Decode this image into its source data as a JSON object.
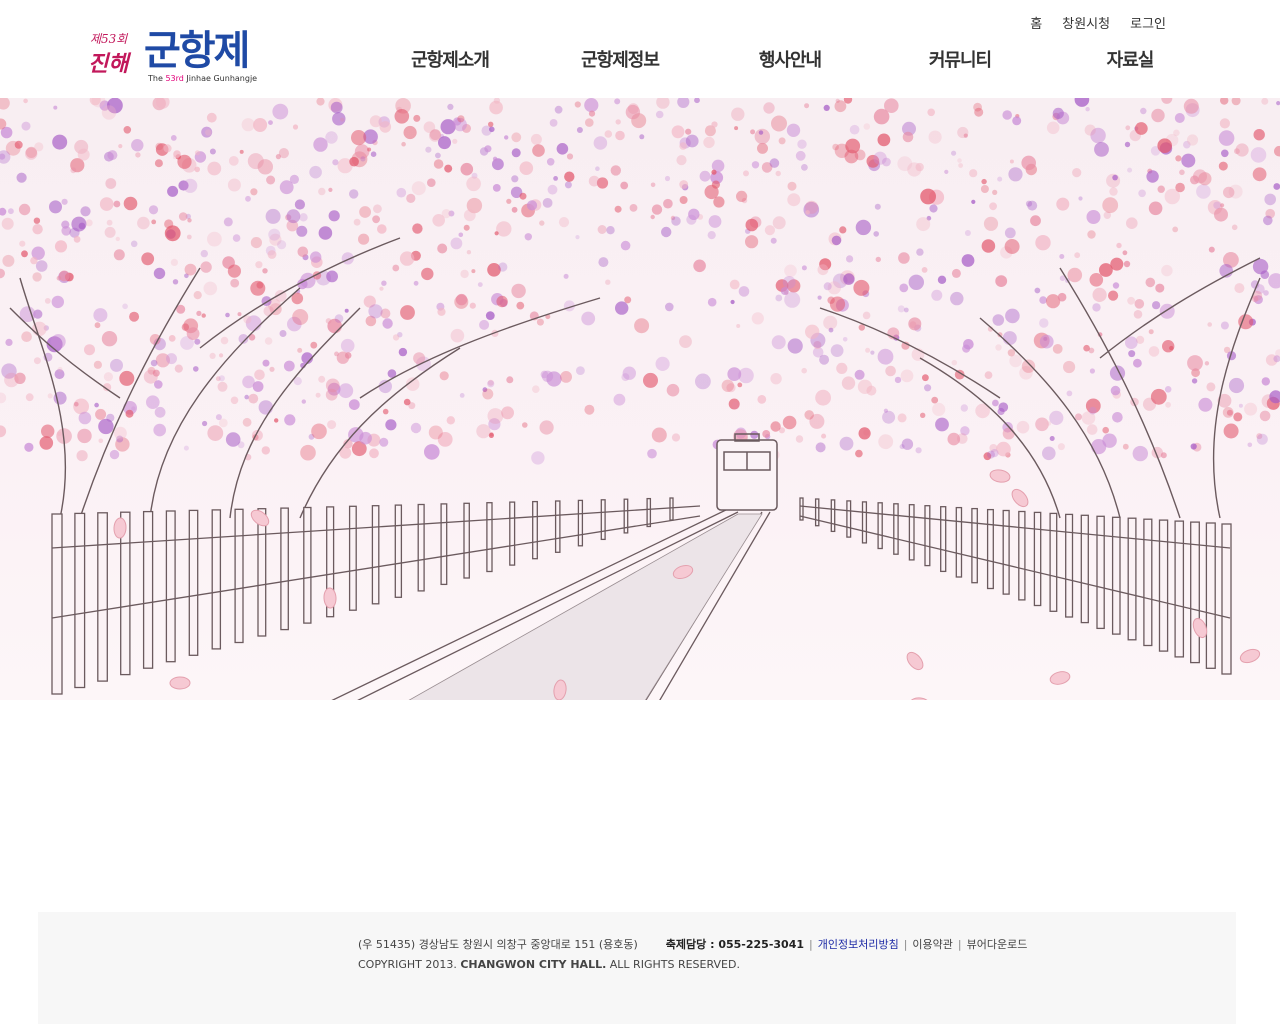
{
  "logo": {
    "edition": "제53회",
    "city": "진해",
    "title": "군항제",
    "english_prefix": "The",
    "english_ordinal": "53rd",
    "english_suffix": "Jinhae Gunhangje"
  },
  "util_menu": [
    "홈",
    "창원시청",
    "로그인"
  ],
  "gnb": [
    "군항제소개",
    "군항제정보",
    "행사안내",
    "커뮤니티",
    "자료실"
  ],
  "footer": {
    "address": "(우 51435) 경상남도 창원시 의창구 중앙대로 151 (용호동)",
    "contact": "축제담당 : 055-225-3041",
    "privacy": "개인정보처리방침",
    "terms": "이용약관",
    "viewer": "뷰어다운로드",
    "copyright_prefix": "COPYRIGHT 2013.",
    "copyright_org": "CHANGWON CITY HALL.",
    "copyright_suffix": "ALL RIGHTS RESERVED."
  },
  "colors": {
    "blossom_pink": "#e88aa2",
    "blossom_purple": "#a65bc6",
    "blossom_red": "#e2566b",
    "privacy_link": "#1e2ba6"
  }
}
